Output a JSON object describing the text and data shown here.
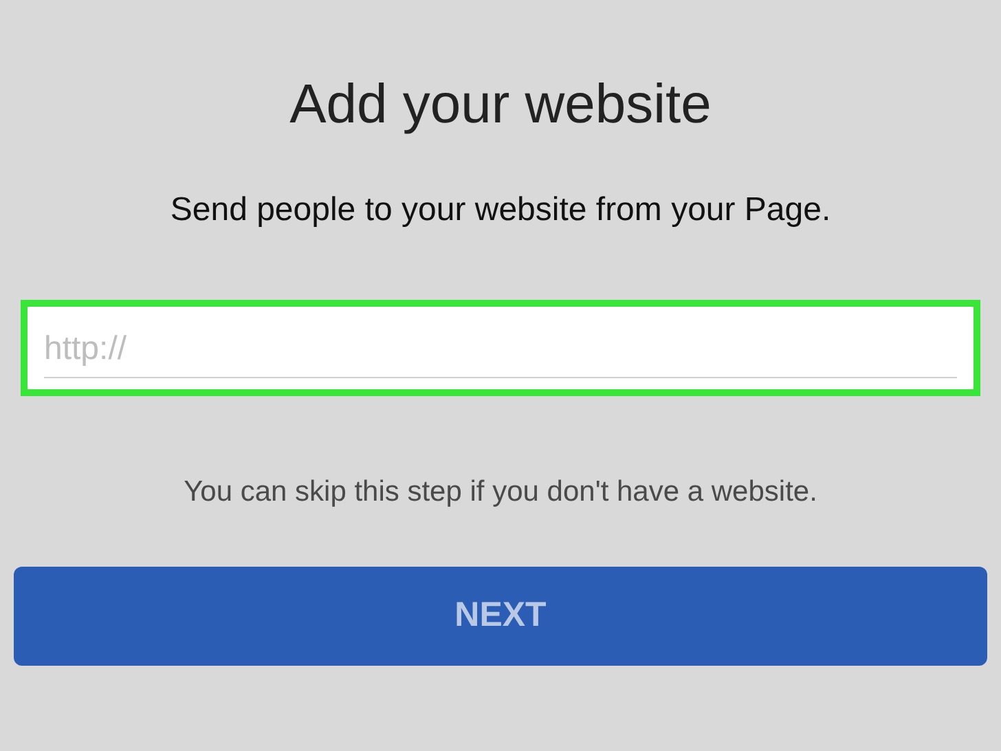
{
  "title": "Add your website",
  "subtitle": "Send people to your website from your Page.",
  "website_field": {
    "placeholder": "http://",
    "highlighted": true
  },
  "hint": "You can skip this step if you don't have a website.",
  "next_button": {
    "label": "NEXT",
    "disabled": true
  }
}
